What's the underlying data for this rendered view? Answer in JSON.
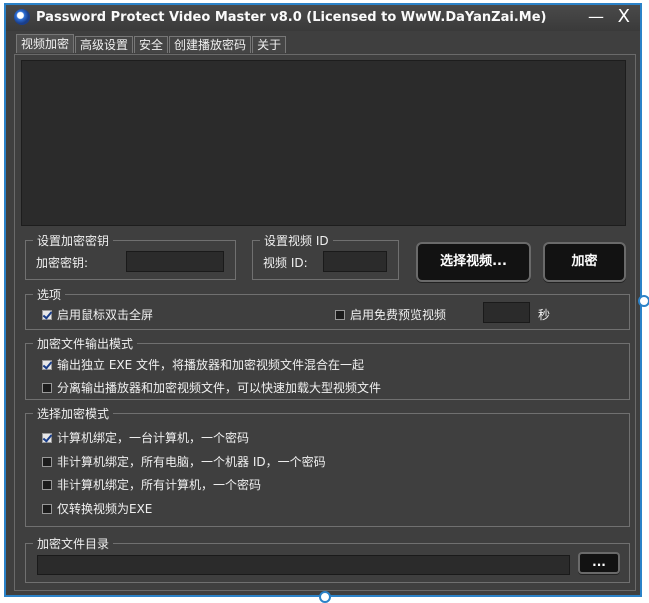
{
  "window": {
    "title": "Password Protect Video Master v8.0 (Licensed to WwW.DaYanZai.Me)",
    "minimize_glyph": "—",
    "close_glyph": "X",
    "accent_color": "#2b82c8"
  },
  "tabs": [
    {
      "label": "视频加密",
      "active": true
    },
    {
      "label": "高级设置",
      "active": false
    },
    {
      "label": "安全",
      "active": false
    },
    {
      "label": "创建播放密码",
      "active": false
    },
    {
      "label": "关于",
      "active": false
    }
  ],
  "key_group": {
    "title": "设置加密密钥",
    "label": "加密密钥:",
    "value": ""
  },
  "id_group": {
    "title": "设置视频 ID",
    "label": "视频 ID:",
    "value": ""
  },
  "buttons": {
    "select_video": "选择视频...",
    "encrypt": "加密",
    "browse": "..."
  },
  "options": {
    "title": "选项",
    "fullscreen": {
      "label": "启用鼠标双击全屏",
      "checked": true
    },
    "preview": {
      "label": "启用免费预览视频",
      "checked": false
    },
    "preview_seconds": "",
    "seconds_unit": "秒"
  },
  "output_mode": {
    "title": "加密文件输出模式",
    "items": [
      {
        "label": "输出独立 EXE 文件，将播放器和加密视频文件混合在一起",
        "checked": true
      },
      {
        "label": "分离输出播放器和加密视频文件，可以快速加载大型视频文件",
        "checked": false
      }
    ]
  },
  "encrypt_mode": {
    "title": "选择加密模式",
    "items": [
      {
        "label": "计算机绑定，一台计算机，一个密码",
        "checked": true
      },
      {
        "label": "非计算机绑定，所有电脑，一个机器 ID，一个密码",
        "checked": false
      },
      {
        "label": "非计算机绑定，所有计算机，一个密码",
        "checked": false
      },
      {
        "label": "仅转换视频为EXE",
        "checked": false
      }
    ]
  },
  "directory": {
    "title": "加密文件目录",
    "value": ""
  }
}
